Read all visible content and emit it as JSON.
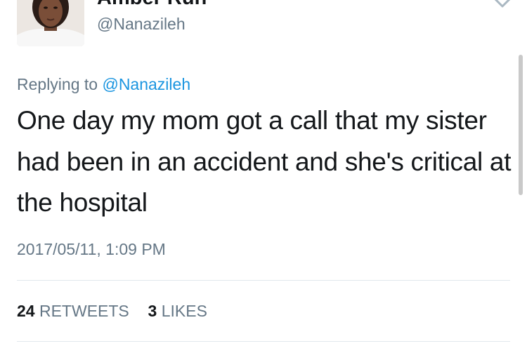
{
  "tweet": {
    "author": {
      "display_name": "Amber Run",
      "handle": "@Nanazileh"
    },
    "replying_to": {
      "prefix": "Replying to",
      "mention": "@Nanazileh"
    },
    "text": "One day my mom got a call that  my sister had been in an accident and she's critical at the hospital",
    "timestamp": "2017/05/11, 1:09 PM",
    "stats": {
      "retweets_count": "24",
      "retweets_label": "RETWEETS",
      "likes_count": "3",
      "likes_label": "LIKES"
    }
  },
  "icons": {
    "menu": "chevron-down-icon"
  },
  "colors": {
    "text": "#14171a",
    "secondary": "#657786",
    "link": "#1b95e0",
    "divider": "#e1e8ed"
  }
}
